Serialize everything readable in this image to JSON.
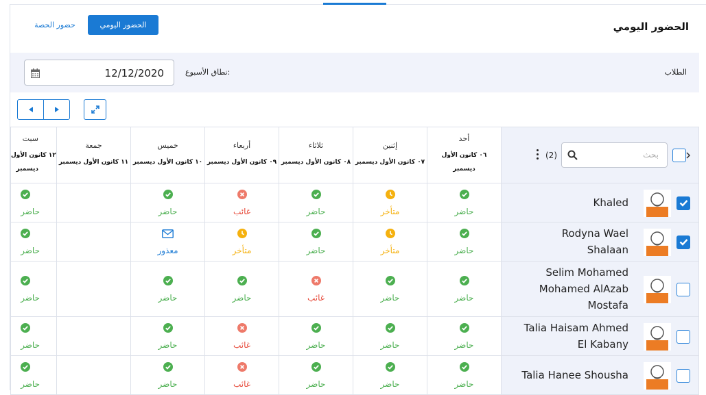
{
  "header": {
    "title": "الحضور اليومي",
    "btn_daily": "الحضور اليومي",
    "btn_class": "حضور الحصة"
  },
  "filters": {
    "students_label": "الطلاب",
    "week_label": "نطاق الأسبوع:",
    "date_value": "12/12/2020"
  },
  "table": {
    "search_placeholder": "بحث",
    "count": "(2)",
    "days": [
      {
        "name": "أحد",
        "sub1": "٠٦ كانون الأول",
        "sub2": "ديسمبر"
      },
      {
        "name": "إثنين",
        "sub1": "٠٧ كانون الأول ديسمبر",
        "sub2": ""
      },
      {
        "name": "ثلاثاء",
        "sub1": "٠٨ كانون الأول ديسمبر",
        "sub2": ""
      },
      {
        "name": "أربعاء",
        "sub1": "٠٩ كانون الأول ديسمبر",
        "sub2": ""
      },
      {
        "name": "خميس",
        "sub1": "١٠ كانون الأول ديسمبر",
        "sub2": ""
      },
      {
        "name": "جمعة",
        "sub1": "١١ كانون الأول ديسمبر",
        "sub2": ""
      },
      {
        "name": "سبت",
        "sub1": "١٢ كانون الأول",
        "sub2": "ديسمبر"
      }
    ],
    "status_labels": {
      "present": "حاضر",
      "late": "متأخر",
      "absent": "غائب",
      "excused": "معذور"
    },
    "rows": [
      {
        "name": "Khaled",
        "checked": true,
        "statuses": [
          "present",
          "late",
          "present",
          "absent",
          "present",
          "",
          "present"
        ]
      },
      {
        "name": "Rodyna Wael Shalaan",
        "checked": true,
        "statuses": [
          "present",
          "late",
          "present",
          "late",
          "excused",
          "",
          "present"
        ]
      },
      {
        "name": "Selim Mohamed Mohamed AlAzab Mostafa",
        "checked": false,
        "statuses": [
          "present",
          "present",
          "absent",
          "present",
          "present",
          "",
          "present"
        ]
      },
      {
        "name": "Talia Haisam Ahmed El Kabany",
        "checked": false,
        "statuses": [
          "present",
          "present",
          "present",
          "absent",
          "present",
          "",
          "present"
        ]
      },
      {
        "name": "Talia Hanee Shousha",
        "checked": false,
        "statuses": [
          "present",
          "present",
          "present",
          "absent",
          "present",
          "",
          "present"
        ]
      }
    ]
  },
  "colors": {
    "accent": "#1a7ad4",
    "present": "#4caf50",
    "late": "#f5b10f",
    "absent": "#e74c3c",
    "excused": "#1a7ad4"
  },
  "icons": {
    "present": "check-circle-icon",
    "late": "clock-icon",
    "absent": "x-circle-icon",
    "excused": "envelope-icon"
  }
}
